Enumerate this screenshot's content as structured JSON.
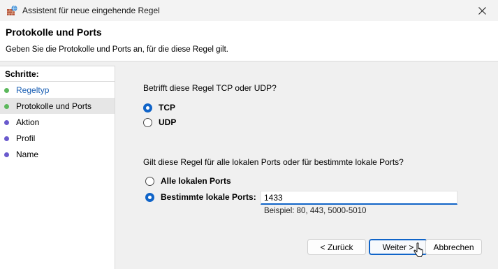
{
  "window": {
    "title": "Assistent für neue eingehende Regel",
    "app_icon": "firewall-wizard-icon",
    "close_icon": "close-icon"
  },
  "header": {
    "title": "Protokolle und Ports",
    "description": "Geben Sie die Protokolle und Ports an, für die diese Regel gilt."
  },
  "steps": {
    "heading": "Schritte:",
    "items": [
      {
        "label": "Regeltyp",
        "state": "done",
        "dot_color": "#5cb85c"
      },
      {
        "label": "Protokolle und Ports",
        "state": "current",
        "dot_color": "#5cb85c"
      },
      {
        "label": "Aktion",
        "state": "pending",
        "dot_color": "#6a5acd"
      },
      {
        "label": "Profil",
        "state": "pending",
        "dot_color": "#6a5acd"
      },
      {
        "label": "Name",
        "state": "pending",
        "dot_color": "#6a5acd"
      }
    ]
  },
  "protocol": {
    "question": "Betrifft diese Regel TCP oder UDP?",
    "options": [
      {
        "label": "TCP",
        "checked": true
      },
      {
        "label": "UDP",
        "checked": false
      }
    ]
  },
  "ports": {
    "question": "Gilt diese Regel für alle lokalen Ports oder für bestimmte lokale Ports?",
    "options": [
      {
        "label": "Alle lokalen Ports",
        "checked": false
      },
      {
        "label": "Bestimmte lokale Ports:",
        "checked": true
      }
    ],
    "value": "1433",
    "example": "Beispiel: 80, 443, 5000-5010"
  },
  "buttons": {
    "back": "< Zurück",
    "next": "Weiter >",
    "cancel": "Abbrechen"
  },
  "colors": {
    "accent": "#1064c8",
    "step_done_text": "#1a5fb4"
  }
}
